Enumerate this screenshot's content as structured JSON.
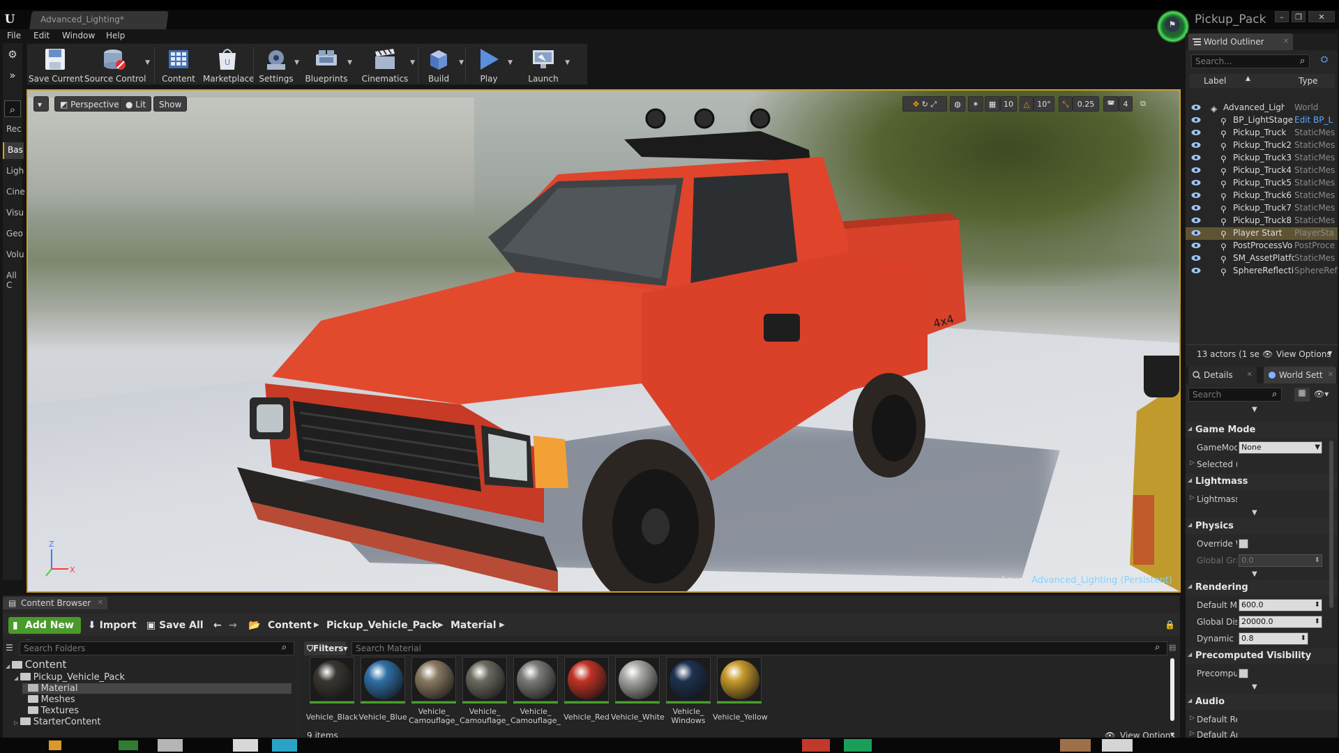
{
  "window": {
    "doc_tab": "Advanced_Lighting*",
    "project_name": "Pickup_Pack"
  },
  "menu": [
    "File",
    "Edit",
    "Window",
    "Help"
  ],
  "modes": [
    "Rec",
    "Bas",
    "Ligh",
    "Cine",
    "Visu",
    "Geo",
    "Volu",
    "All C"
  ],
  "toolbar": [
    {
      "label": "Save Current",
      "icon": "save-icon"
    },
    {
      "label": "Source Control",
      "icon": "source-control-icon"
    },
    {
      "label": "Content",
      "icon": "content-icon"
    },
    {
      "label": "Marketplace",
      "icon": "marketplace-icon"
    },
    {
      "label": "Settings",
      "icon": "settings-icon"
    },
    {
      "label": "Blueprints",
      "icon": "blueprints-icon"
    },
    {
      "label": "Cinematics",
      "icon": "cinematics-icon"
    },
    {
      "label": "Build",
      "icon": "build-icon"
    },
    {
      "label": "Play",
      "icon": "play-icon"
    },
    {
      "label": "Launch",
      "icon": "launch-icon"
    }
  ],
  "viewport": {
    "perspective_label": "Perspective",
    "lit_label": "Lit",
    "show_label": "Show",
    "grid_snap": "10",
    "rotation_snap": "10°",
    "scale_snap": "0.25",
    "camera_speed": "4",
    "level_prefix": "Level:",
    "level_name": "Advanced_Lighting (Persistent)",
    "axis_z": "Z",
    "axis_x": "X"
  },
  "outliner": {
    "tab_title": "World Outliner",
    "search_placeholder": "Search...",
    "col_label": "Label",
    "col_type": "Type",
    "rows": [
      {
        "name": "Advanced_Lightir",
        "type": "World",
        "selected": false,
        "link": false
      },
      {
        "name": "BP_LightStage",
        "type": "Edit BP_L",
        "selected": false,
        "link": true
      },
      {
        "name": "Pickup_Truck",
        "type": "StaticMes",
        "selected": false,
        "link": false
      },
      {
        "name": "Pickup_Truck2",
        "type": "StaticMes",
        "selected": false,
        "link": false
      },
      {
        "name": "Pickup_Truck3",
        "type": "StaticMes",
        "selected": false,
        "link": false
      },
      {
        "name": "Pickup_Truck4",
        "type": "StaticMes",
        "selected": false,
        "link": false
      },
      {
        "name": "Pickup_Truck5",
        "type": "StaticMes",
        "selected": false,
        "link": false
      },
      {
        "name": "Pickup_Truck6",
        "type": "StaticMes",
        "selected": false,
        "link": false
      },
      {
        "name": "Pickup_Truck7",
        "type": "StaticMes",
        "selected": false,
        "link": false
      },
      {
        "name": "Pickup_Truck8",
        "type": "StaticMes",
        "selected": false,
        "link": false
      },
      {
        "name": "Player Start",
        "type": "PlayerSta",
        "selected": true,
        "link": false
      },
      {
        "name": "PostProcessVo",
        "type": "PostProce",
        "selected": false,
        "link": false
      },
      {
        "name": "SM_AssetPlatfc",
        "type": "StaticMes",
        "selected": false,
        "link": false
      },
      {
        "name": "SphereReflectic",
        "type": "SphereRef",
        "selected": false,
        "link": false
      }
    ],
    "actor_count": "13 actors (1 se",
    "view_options": "View Options"
  },
  "details": {
    "tab_details": "Details",
    "tab_world": "World Sett",
    "search_placeholder": "Search",
    "sections": {
      "game_mode": "Game Mode",
      "gamemod_label": "GameMod",
      "gamemod_value": "None",
      "selected_label": "Selected (",
      "lightmass": "Lightmass",
      "lightmass_label": "Lightmass",
      "physics": "Physics",
      "override_label": "Override W",
      "global_grav_label": "Global Grav",
      "global_grav_value": "0.0",
      "rendering": "Rendering",
      "default_max_label": "Default Ma",
      "default_max_value": "600.0",
      "global_dist_label": "Global Dist",
      "global_dist_value": "20000.0",
      "dynamic_label": "Dynamic Ir",
      "dynamic_value": "0.8",
      "precomputed": "Precomputed Visibility",
      "precomput_label": "Precomput",
      "audio": "Audio",
      "default_rev_label": "Default Rev",
      "default_am_label": "Default Am"
    }
  },
  "content_browser": {
    "tab_title": "Content Browser",
    "add_new": "Add New",
    "import": "Import",
    "save_all": "Save All",
    "breadcrumb": [
      "Content",
      "Pickup_Vehicle_Pack",
      "Material"
    ],
    "search_folders": "Search Folders",
    "filters": "Filters",
    "search_material": "Search Material",
    "tree": [
      {
        "label": "Content",
        "depth": 0,
        "selected": false
      },
      {
        "label": "Pickup_Vehicle_Pack",
        "depth": 1,
        "selected": false
      },
      {
        "label": "Material",
        "depth": 2,
        "selected": true
      },
      {
        "label": "Meshes",
        "depth": 2,
        "selected": false
      },
      {
        "label": "Textures",
        "depth": 2,
        "selected": false
      },
      {
        "label": "StarterContent",
        "depth": 1,
        "selected": false
      }
    ],
    "assets": [
      {
        "line1": "Vehicle_Black",
        "line2": "",
        "color": "#3a3632"
      },
      {
        "line1": "Vehicle_Blue",
        "line2": "",
        "color": "#2f6fa8"
      },
      {
        "line1": "Vehicle_",
        "line2": "Camouflage_",
        "color": "#8a7a63"
      },
      {
        "line1": "Vehicle_",
        "line2": "Camouflage_",
        "color": "#6d6a60"
      },
      {
        "line1": "Vehicle_",
        "line2": "Camouflage_",
        "color": "#7b7b77"
      },
      {
        "line1": "Vehicle_Red",
        "line2": "",
        "color": "#c23326"
      },
      {
        "line1": "Vehicle_White",
        "line2": "",
        "color": "#a9a9a6"
      },
      {
        "line1": "Vehicle_",
        "line2": "Windows",
        "color": "#1d3150"
      },
      {
        "line1": "Vehicle_Yellow",
        "line2": "",
        "color": "#c69a2b"
      }
    ],
    "item_count": "9 items",
    "view_options": "View Options"
  }
}
